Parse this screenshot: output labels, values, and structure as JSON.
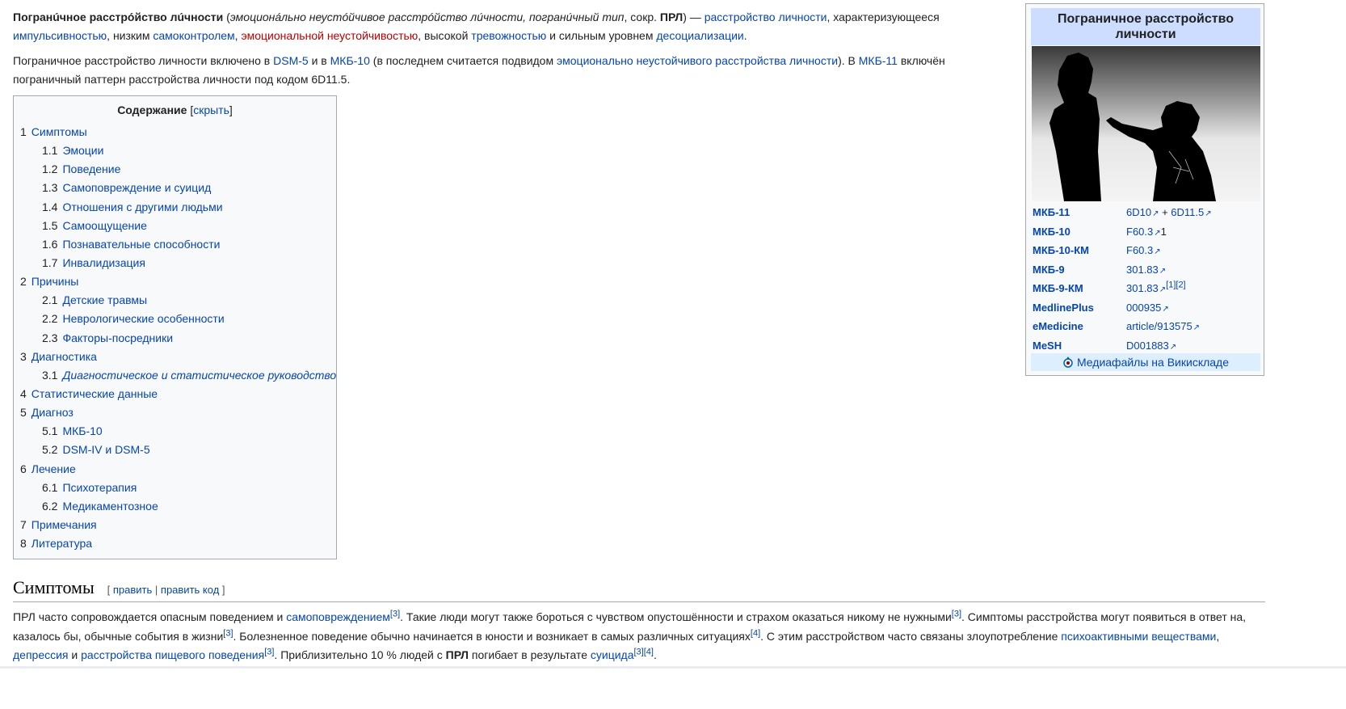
{
  "intro": {
    "term_bold": "Погранúчное расстрóйство лúчности",
    "paren_open": " (",
    "alt_names": "эмоционáльно неустóйчивое расстрóйство лúчности, погранúчный тип",
    "abbr_prefix": ", сокр. ",
    "abbr": "ПРЛ",
    "paren_close": ") — ",
    "link_personality_disorder": "расстройство личности",
    "t1": ", характеризующееся ",
    "link_impulsivity": "импульсивностью",
    "t2": ", низким ",
    "link_selfcontrol": "самоконтролем",
    "t3": ", ",
    "link_emotional_instability": "эмоциональной неустойчивостью",
    "t4": ", высокой ",
    "link_anxiety": "тревожностью",
    "t5": " и сильным уровнем ",
    "link_desocialization": "десоциализации",
    "t6": "."
  },
  "para2": {
    "t1": "Пограничное расстройство личности включено в ",
    "link_dsm5": "DSM-5",
    "t2": " и в ",
    "link_icd10": "МКБ-10",
    "t3": " (в последнем считается подвидом ",
    "link_eupd": "эмоционально неустойчивого расстройства личности",
    "t4": "). В ",
    "link_icd11": "МКБ-11",
    "t5": " включён пограничный паттерн расстройства личности под кодом 6D11.5."
  },
  "toc": {
    "title": "Содержание",
    "bracket_open": "[",
    "toggle": "скрыть",
    "bracket_close": "]",
    "items": [
      {
        "num": "1",
        "label": "Симптомы",
        "level": 1
      },
      {
        "num": "1.1",
        "label": "Эмоции",
        "level": 2
      },
      {
        "num": "1.2",
        "label": "Поведение",
        "level": 2
      },
      {
        "num": "1.3",
        "label": "Самоповреждение и суицид",
        "level": 2
      },
      {
        "num": "1.4",
        "label": "Отношения с другими людьми",
        "level": 2
      },
      {
        "num": "1.5",
        "label": "Самоощущение",
        "level": 2
      },
      {
        "num": "1.6",
        "label": "Познавательные способности",
        "level": 2
      },
      {
        "num": "1.7",
        "label": "Инвалидизация",
        "level": 2
      },
      {
        "num": "2",
        "label": "Причины",
        "level": 1
      },
      {
        "num": "2.1",
        "label": "Детские травмы",
        "level": 2
      },
      {
        "num": "2.2",
        "label": "Неврологические особенности",
        "level": 2
      },
      {
        "num": "2.3",
        "label": "Факторы-посредники",
        "level": 2
      },
      {
        "num": "3",
        "label": "Диагностика",
        "level": 1
      },
      {
        "num": "3.1",
        "label": "Диагностическое и статистическое руководство",
        "level": 2,
        "italic": true
      },
      {
        "num": "4",
        "label": "Статистические данные",
        "level": 1
      },
      {
        "num": "5",
        "label": "Диагноз",
        "level": 1
      },
      {
        "num": "5.1",
        "label": "МКБ-10",
        "level": 2
      },
      {
        "num": "5.2",
        "label": "DSM-IV и DSM-5",
        "level": 2
      },
      {
        "num": "6",
        "label": "Лечение",
        "level": 1
      },
      {
        "num": "6.1",
        "label": "Психотерапия",
        "level": 2
      },
      {
        "num": "6.2",
        "label": "Медикаментозное",
        "level": 2
      },
      {
        "num": "7",
        "label": "Примечания",
        "level": 1
      },
      {
        "num": "8",
        "label": "Литература",
        "level": 1
      }
    ]
  },
  "infobox": {
    "title": "Пограничное расстройство личности",
    "rows": [
      {
        "key": "МКБ-11",
        "v1": "6D10",
        "sep": " + ",
        "v2": "6D11.5"
      },
      {
        "key": "МКБ-10",
        "v1": "F60.3",
        "tail": "1"
      },
      {
        "key": "МКБ-10-КМ",
        "v1": "F60.3"
      },
      {
        "key": "МКБ-9",
        "v1": "301.83"
      },
      {
        "key": "МКБ-9-КМ",
        "v1": "301.83",
        "sup": "[1][2]"
      },
      {
        "key": "MedlinePlus",
        "v1": "000935"
      },
      {
        "key": "eMedicine",
        "v1": "article/913575"
      },
      {
        "key": "MeSH",
        "v1": "D001883"
      }
    ],
    "commons_label": "Медиафайлы на Викискладе"
  },
  "section": {
    "title": "Симптомы",
    "edit_open": "[ ",
    "edit": "править",
    "edit_sep": " | ",
    "edit_code": "править код",
    "edit_close": " ]"
  },
  "para3": {
    "t1": "ПРЛ часто сопровождается опасным поведением и ",
    "link_selfharm": "самоповреждением",
    "ref1": "[3]",
    "t2": ". Такие люди могут также бороться с чувством опустошённости и страхом оказаться никому не нужными",
    "ref2": "[3]",
    "t3": ". Симптомы расстройства могут появиться в ответ на, казалось бы, обычные события в жизни",
    "ref3": "[3]",
    "t4": ". Болезненное поведение обычно начинается в юности и возникает в самых различных ситуациях",
    "ref4": "[4]",
    "t5": ". С этим расстройством часто связаны злоупотребление ",
    "link_substances": "психоактивными веществами",
    "t6": ", ",
    "link_depression": "депрессия",
    "t7": " и ",
    "link_eating": "расстройства пищевого поведения",
    "ref5": "[3]",
    "t8": ". Приблизительно 10 % людей с ",
    "abbr": "ПРЛ",
    "t9": " погибает в результате ",
    "link_suicide": "суицида",
    "ref6": "[3][4]",
    "t10": "."
  }
}
